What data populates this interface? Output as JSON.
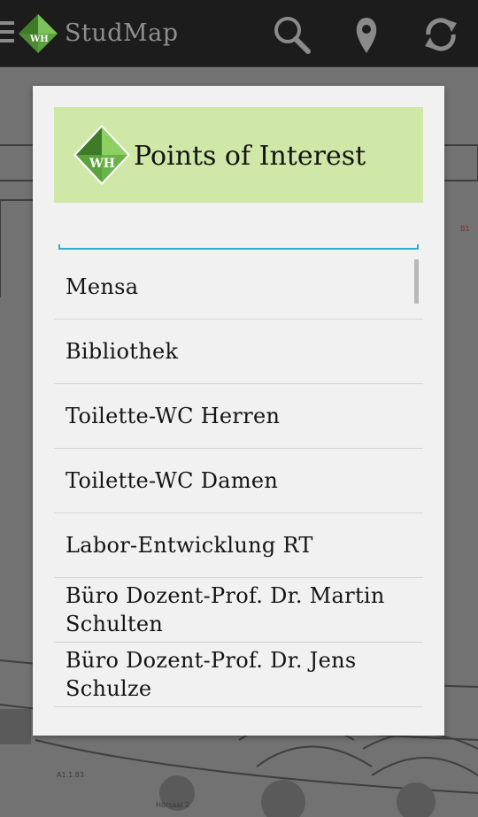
{
  "action_bar": {
    "app_title": "StudMap",
    "icons": [
      "menu-icon",
      "app-logo-icon",
      "search-icon",
      "location-icon",
      "refresh-icon"
    ]
  },
  "dialog": {
    "title": "Points of Interest",
    "search": {
      "value": "",
      "placeholder": ""
    },
    "items": [
      "Mensa",
      "Bibliothek",
      "Toilette-WC Herren",
      "Toilette-WC Damen",
      "Labor-Entwicklung RT",
      "Büro Dozent-Prof. Dr. Martin Schulten",
      "Büro Dozent-Prof. Dr. Jens Schulze"
    ]
  },
  "map": {
    "labels": [
      "B1",
      "A1.1.83",
      "Hörsaal 2"
    ]
  },
  "colors": {
    "action_bar": "#1c1c1c",
    "dialog_header": "#cfe8a8",
    "accent": "#33aacc",
    "logo_green": "#5aa23c"
  }
}
